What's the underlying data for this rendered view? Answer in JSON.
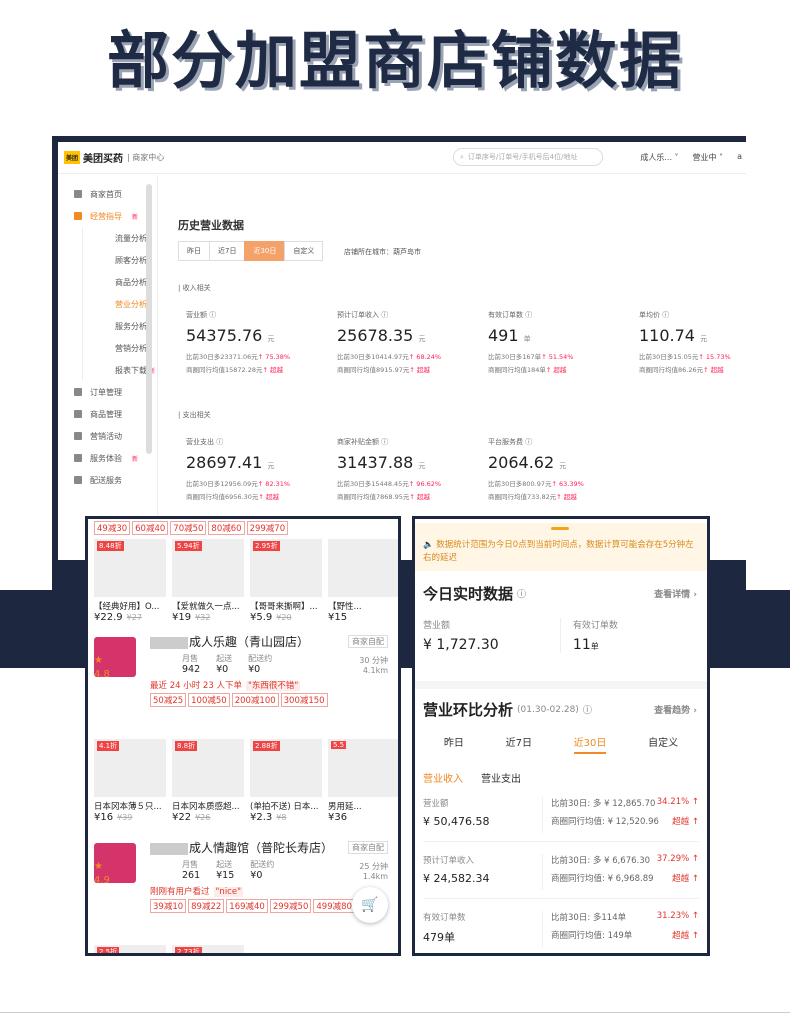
{
  "headline": "部分加盟商店铺数据",
  "desktop": {
    "logo_icon": "美团",
    "logo": "美团买药",
    "logo_sub": "| 商家中心",
    "search_placeholder": "订单序号/订单号/手机号后4位/地址",
    "top_right": [
      "成人乐... ˅",
      "营业中 ˅",
      "a"
    ],
    "sidebar": [
      {
        "label": "商家首页",
        "type": "item"
      },
      {
        "label": "经营指导",
        "type": "item",
        "active": true,
        "new": "新"
      },
      {
        "label": "流量分析",
        "type": "sub"
      },
      {
        "label": "顾客分析",
        "type": "sub"
      },
      {
        "label": "商品分析",
        "type": "sub"
      },
      {
        "label": "营业分析",
        "type": "sub",
        "active": true
      },
      {
        "label": "服务分析",
        "type": "sub"
      },
      {
        "label": "营销分析",
        "type": "sub"
      },
      {
        "label": "报表下载",
        "type": "sub",
        "new": "新"
      },
      {
        "label": "订单管理",
        "type": "item"
      },
      {
        "label": "商品管理",
        "type": "item"
      },
      {
        "label": "营销活动",
        "type": "item"
      },
      {
        "label": "服务体验",
        "type": "item",
        "new": "新"
      },
      {
        "label": "配送服务",
        "type": "item"
      }
    ],
    "section_title": "历史营业数据",
    "ranges": [
      "昨日",
      "近7日",
      "近30日",
      "自定义"
    ],
    "city": "店铺所在城市：葫芦岛市",
    "income_label": "| 收入相关",
    "expense_label": "| 支出相关",
    "income": [
      {
        "name": "营业额 ⓘ",
        "value": "54375.76",
        "unit": "元",
        "line1a": "比前30日多23371.06元",
        "line1b": "↑ 75.38%",
        "line2a": "商圈同行均值15872.28元",
        "line2b": "↑ 超越"
      },
      {
        "name": "预计订单收入 ⓘ",
        "value": "25678.35",
        "unit": "元",
        "line1a": "比前30日多10414.97元",
        "line1b": "↑ 68.24%",
        "line2a": "商圈同行均值8915.97元",
        "line2b": "↑ 超越"
      },
      {
        "name": "有效订单数 ⓘ",
        "value": "491",
        "unit": "单",
        "line1a": "比前30日多167单",
        "line1b": "↑ 51.54%",
        "line2a": "商圈同行均值184单",
        "line2b": "↑ 超越"
      },
      {
        "name": "单均价 ⓘ",
        "value": "110.74",
        "unit": "元",
        "line1a": "比前30日多15.05元",
        "line1b": "↑ 15.73%",
        "line2a": "商圈同行均值86.26元",
        "line2b": "↑ 超越"
      }
    ],
    "expense": [
      {
        "name": "营业支出 ⓘ",
        "value": "28697.41",
        "unit": "元",
        "line1a": "比前30日多12956.09元",
        "line1b": "↑ 82.31%",
        "line2a": "商圈同行均值6956.30元",
        "line2b": "↑ 超越"
      },
      {
        "name": "商家补贴金额 ⓘ",
        "value": "31437.88",
        "unit": "元",
        "line1a": "比前30日多15448.45元",
        "line1b": "↑ 96.62%",
        "line2a": "商圈同行均值7868.95元",
        "line2b": "↑ 超越"
      },
      {
        "name": "平台服务费 ⓘ",
        "value": "2064.62",
        "unit": "元",
        "line1a": "比前30日多800.97元",
        "line1b": "↑ 63.39%",
        "line2a": "商圈同行均值733.82元",
        "line2b": "↑ 超越"
      }
    ]
  },
  "shop": {
    "chips_top": [
      "49减30",
      "60减40",
      "70减50",
      "80减60",
      "299减70"
    ],
    "prods_top": [
      {
        "tag": "8.48折",
        "name": "【经典好用】O...",
        "price": "¥22.9",
        "old": "¥27"
      },
      {
        "tag": "5.94折",
        "name": "【爱就做久一点...",
        "price": "¥19",
        "old": "¥32"
      },
      {
        "tag": "2.95折",
        "name": "【哥哥来撕啊】...",
        "price": "¥5.9",
        "old": "¥20"
      },
      {
        "tag": "",
        "name": "【野性...",
        "price": "¥15",
        "old": ""
      }
    ],
    "store1": {
      "name": "成人乐趣（青山园店）",
      "badge": "商家自配",
      "rating": "4.8",
      "sales_l": "月售",
      "sales": "942",
      "start_l": "起送",
      "start": "¥0",
      "deliv_l": "配送约",
      "deliv": "¥0",
      "time": "30 分钟",
      "dist": "4.1km",
      "promo": "最近 24 小时 23 人下单",
      "quote": "\"东西很不错\"",
      "chips": [
        "50减25",
        "100减50",
        "200减100",
        "300减150"
      ],
      "prods": [
        {
          "tag": "4.1折",
          "name": "日本冈本薄５只...",
          "price": "¥16",
          "old": "¥39"
        },
        {
          "tag": "8.8折",
          "name": "日本冈本质感超...",
          "price": "¥22",
          "old": "¥26"
        },
        {
          "tag": "2.88折",
          "name": "(单拍不送) 日本...",
          "price": "¥2.3",
          "old": "¥8"
        },
        {
          "tag": "5.5",
          "name": "男用延...",
          "price": "¥36",
          "old": ""
        }
      ]
    },
    "store2": {
      "name": "成人情趣馆（普陀长寿店）",
      "badge": "商家自配",
      "rating": "4.9",
      "sales_l": "月售",
      "sales": "261",
      "start_l": "起送",
      "start": "¥15",
      "deliv_l": "配送约",
      "deliv": "¥0",
      "time": "25 分钟",
      "dist": "1.4km",
      "promo": "刚刚有用户看过",
      "quote": "\"nice\"",
      "chips": [
        "39减10",
        "89减22",
        "169减40",
        "299减50",
        "499减80"
      ]
    },
    "tags_bottom": [
      "2.5折",
      "2.73折"
    ]
  },
  "mobile": {
    "notice": "数据统计范围为今日0点到当前时间点，数据计算可能会存在5分钟左右的延迟",
    "realtime_title": "今日实时数据",
    "realtime_link": "查看详情 ›",
    "rev_label": "营业额",
    "rev_value": "¥ 1,727.30",
    "ord_label": "有效订单数",
    "ord_value": "11",
    "ord_unit": "单",
    "cmp_title": "营业环比分析",
    "cmp_date": "(01.30-02.28)",
    "cmp_link": "查看趋势 ›",
    "tabs": [
      "昨日",
      "近7日",
      "近30日",
      "自定义"
    ],
    "sub_tabs": [
      "营业收入",
      "营业支出"
    ],
    "rows": [
      {
        "label": "营业额",
        "value": "¥ 50,476.58",
        "r1l": "比前30日: 多 ¥ 12,865.70",
        "r1r": "34.21% ↑",
        "r2l": "商圈同行均值: ¥ 12,520.96",
        "r2r": "超越 ↑"
      },
      {
        "label": "预计订单收入",
        "value": "¥ 24,582.34",
        "r1l": "比前30日: 多 ¥ 6,676.30",
        "r1r": "37.29% ↑",
        "r2l": "商圈同行均值: ¥ 6,968.89",
        "r2r": "超越 ↑"
      },
      {
        "label": "有效订单数",
        "value": "479单",
        "r1l": "比前30日: 多114单",
        "r1r": "31.23% ↑",
        "r2l": "商圈同行均值: 149单",
        "r2r": "超越 ↑"
      }
    ]
  }
}
